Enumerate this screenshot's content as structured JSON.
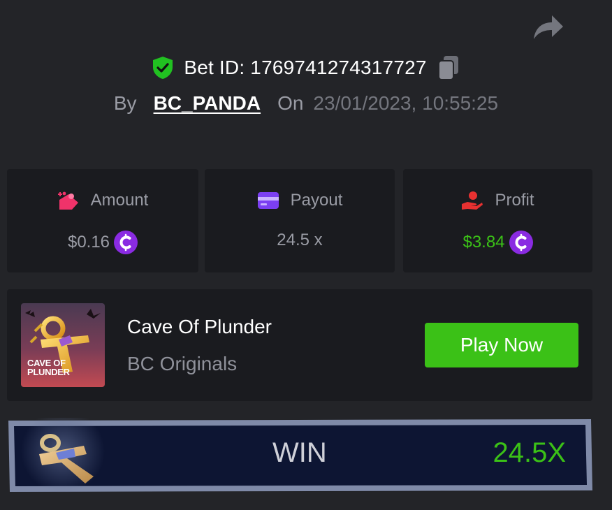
{
  "header": {
    "bet_id_label": "Bet ID:",
    "bet_id_value": "1769741274317727",
    "bet_id_text": "Bet ID: 1769741274317727",
    "by_label": "By",
    "username": "BC_PANDA",
    "on_label": "On",
    "datetime": "23/01/2023, 10:55:25"
  },
  "stats": {
    "amount": {
      "label": "Amount",
      "value": "$0.16"
    },
    "payout": {
      "label": "Payout",
      "value": "24.5 x"
    },
    "profit": {
      "label": "Profit",
      "value": "$3.84"
    }
  },
  "game": {
    "thumb_text_line1": "CAVE OF",
    "thumb_text_line2": "PLUNDER",
    "title": "Cave Of Plunder",
    "provider": "BC Originals",
    "play_label": "Play Now"
  },
  "result": {
    "label": "WIN",
    "multiplier": "24.5X"
  },
  "colors": {
    "background": "#232428",
    "card": "#1a1b1f",
    "accent_green": "#3bc117",
    "coin_purple": "#8a2be2",
    "muted_text": "#9a9ca5"
  },
  "icons": {
    "share": "share-arrow-icon",
    "shield": "shield-check-icon",
    "copy": "copy-icon",
    "amount": "money-bag-icon",
    "payout": "card-icon",
    "profit": "hand-coin-icon",
    "coin": "bcd-coin-icon",
    "ankh": "ankh-icon"
  }
}
